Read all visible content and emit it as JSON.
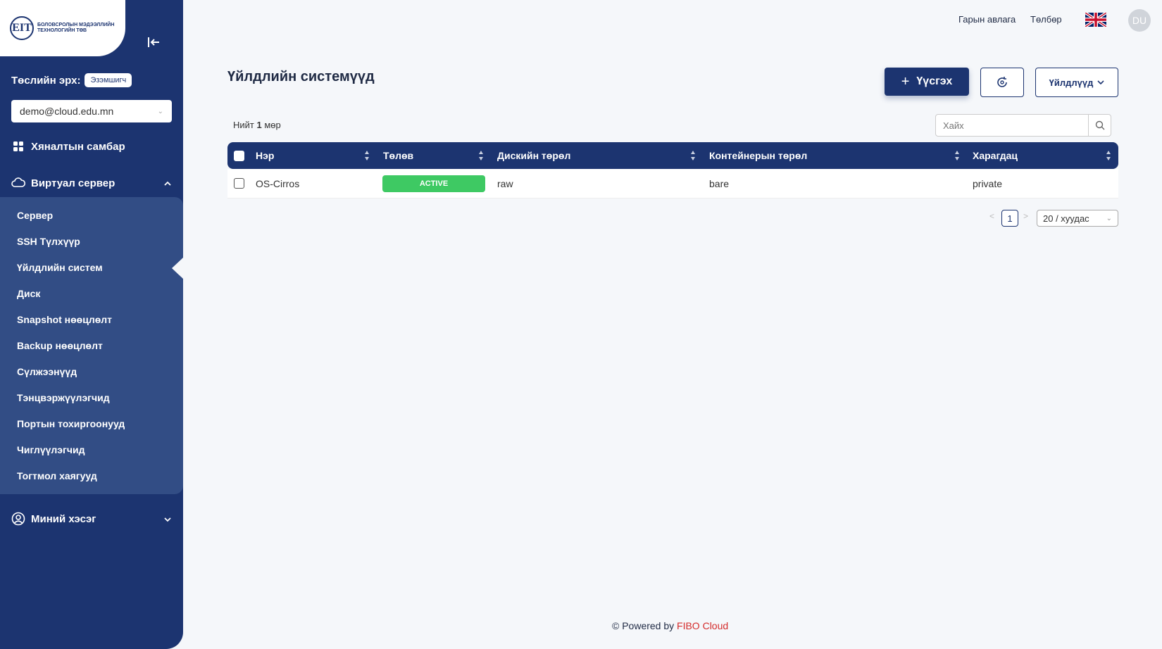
{
  "logo": {
    "mark": "ЕIТ",
    "text": "БОЛОВСРОЛЫН МЭДЭЭЛЛИЙН ТЕХНОЛОГИЙН ТӨВ"
  },
  "sidebar": {
    "role_label": "Төслийн эрх:",
    "role_value": "Эзэмшигч",
    "account": "demo@cloud.edu.mn",
    "dashboard": "Хяналтын самбар",
    "virtual_server": "Виртуал сервер",
    "sub_items": [
      "Сервер",
      "SSH Түлхүүр",
      "Үйлдлийн систем",
      "Диск",
      "Snapshot нөөцлөлт",
      "Backup нөөцлөлт",
      "Сүлжээнүүд",
      "Тэнцвэржүүлэгчид",
      "Портын тохиргоонууд",
      "Чиглүүлэгчид",
      "Тогтмол хаягууд"
    ],
    "my_section": "Миний хэсэг"
  },
  "topbar": {
    "guide": "Гарын авлага",
    "payment": "Төлбөр",
    "avatar": "DU"
  },
  "main": {
    "title": "Үйлдлийн системүүд",
    "create_label": "Үүсгэх",
    "actions_label": "Үйлдлүүд",
    "total_prefix": "Нийт",
    "total_count": "1",
    "total_suffix": "мөр",
    "search_placeholder": "Хайх"
  },
  "table": {
    "columns": [
      "Нэр",
      "Төлөв",
      "Дискийн төрөл",
      "Контейнерын төрөл",
      "Харагдац"
    ],
    "rows": [
      {
        "name": "OS-Cirros",
        "status": "ACTIVE",
        "disk": "raw",
        "container": "bare",
        "visibility": "private"
      }
    ]
  },
  "pagination": {
    "page": "1",
    "page_size": "20 / хуудас"
  },
  "footer": {
    "prefix": "© Powered by",
    "brand": "FIBO Cloud"
  },
  "colors": {
    "primary": "#1c3470",
    "active": "#3ec963",
    "brand_red": "#d42b2b",
    "background": "#f5f7fa"
  }
}
